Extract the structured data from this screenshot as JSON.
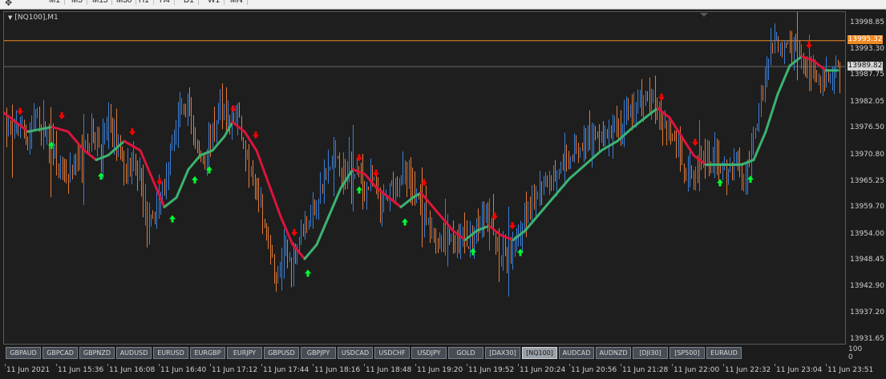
{
  "toolbar": {
    "timeframes": [
      "M1",
      "M5",
      "M15",
      "M30",
      "H1",
      "H4",
      "D1",
      "W1",
      "MN"
    ]
  },
  "chart": {
    "symbol_title": "[NQ100],M1",
    "bid_price": "13995.32",
    "current_price": "13989.82",
    "price_axis_labels": [
      "13998.85",
      "13993.30",
      "13987.75",
      "13982.05",
      "13976.50",
      "13970.80",
      "13965.25",
      "13959.70",
      "13954.00",
      "13948.45",
      "13942.90",
      "13937.20",
      "13931.65"
    ],
    "time_axis_labels": [
      "11 Jun 2021",
      "11 Jun 15:36",
      "11 Jun 16:08",
      "11 Jun 16:40",
      "11 Jun 17:12",
      "11 Jun 17:44",
      "11 Jun 18:16",
      "11 Jun 18:48",
      "11 Jun 19:20",
      "11 Jun 19:52",
      "11 Jun 20:24",
      "11 Jun 20:56",
      "11 Jun 21:28",
      "11 Jun 22:00",
      "11 Jun 22:32",
      "11 Jun 23:04",
      "11 Jun 23:51"
    ],
    "colors": {
      "background": "#1e1e1e",
      "bull_bar": "#3a7fd8",
      "bear_bar": "#e07a3a",
      "ma_up": "#3cb371",
      "ma_down": "#dc143c",
      "bid_line": "#f08a24",
      "arrow_up": "#00ff33",
      "arrow_down": "#ff0000"
    }
  },
  "chart_data": {
    "type": "ohlc",
    "y_range": [
      13931.65,
      13998.85
    ],
    "price_path": [
      [
        0,
        13980
      ],
      [
        10,
        13975
      ],
      [
        20,
        13978
      ],
      [
        30,
        13973
      ],
      [
        40,
        13980
      ],
      [
        50,
        13976
      ],
      [
        60,
        13974
      ],
      [
        70,
        13968
      ],
      [
        80,
        13965
      ],
      [
        90,
        13969
      ],
      [
        100,
        13972
      ],
      [
        110,
        13976
      ],
      [
        120,
        13972
      ],
      [
        130,
        13978
      ],
      [
        140,
        13975
      ],
      [
        150,
        13968
      ],
      [
        160,
        13970
      ],
      [
        170,
        13965
      ],
      [
        180,
        13955
      ],
      [
        190,
        13960
      ],
      [
        200,
        13965
      ],
      [
        210,
        13975
      ],
      [
        220,
        13980
      ],
      [
        230,
        13982
      ],
      [
        240,
        13972
      ],
      [
        250,
        13970
      ],
      [
        260,
        13976
      ],
      [
        270,
        13982
      ],
      [
        280,
        13978
      ],
      [
        290,
        13980
      ],
      [
        300,
        13972
      ],
      [
        310,
        13966
      ],
      [
        320,
        13960
      ],
      [
        330,
        13950
      ],
      [
        340,
        13945
      ],
      [
        350,
        13950
      ],
      [
        360,
        13948
      ],
      [
        370,
        13955
      ],
      [
        380,
        13958
      ],
      [
        390,
        13962
      ],
      [
        400,
        13966
      ],
      [
        410,
        13970
      ],
      [
        420,
        13968
      ],
      [
        430,
        13966
      ],
      [
        440,
        13968
      ],
      [
        450,
        13963
      ],
      [
        460,
        13966
      ],
      [
        470,
        13960
      ],
      [
        480,
        13963
      ],
      [
        490,
        13966
      ],
      [
        500,
        13968
      ],
      [
        510,
        13963
      ],
      [
        520,
        13960
      ],
      [
        530,
        13955
      ],
      [
        540,
        13953
      ],
      [
        550,
        13955
      ],
      [
        560,
        13952
      ],
      [
        570,
        13954
      ],
      [
        580,
        13953
      ],
      [
        590,
        13956
      ],
      [
        600,
        13958
      ],
      [
        610,
        13954
      ],
      [
        620,
        13950
      ],
      [
        630,
        13952
      ],
      [
        640,
        13955
      ],
      [
        650,
        13958
      ],
      [
        660,
        13962
      ],
      [
        670,
        13966
      ],
      [
        680,
        13965
      ],
      [
        690,
        13968
      ],
      [
        700,
        13970
      ],
      [
        710,
        13972
      ],
      [
        720,
        13973
      ],
      [
        730,
        13975
      ],
      [
        740,
        13976
      ],
      [
        750,
        13975
      ],
      [
        760,
        13977
      ],
      [
        770,
        13978
      ],
      [
        780,
        13980
      ],
      [
        790,
        13982
      ],
      [
        800,
        13983
      ],
      [
        810,
        13982
      ],
      [
        820,
        13978
      ],
      [
        830,
        13975
      ],
      [
        840,
        13972
      ],
      [
        850,
        13968
      ],
      [
        860,
        13966
      ],
      [
        870,
        13970
      ],
      [
        880,
        13969
      ],
      [
        890,
        13970
      ],
      [
        900,
        13968
      ],
      [
        910,
        13970
      ],
      [
        920,
        13966
      ],
      [
        930,
        13970
      ],
      [
        940,
        13980
      ],
      [
        950,
        13990
      ],
      [
        960,
        13995
      ],
      [
        970,
        13993
      ],
      [
        980,
        13995
      ],
      [
        990,
        13992
      ],
      [
        1000,
        13990
      ],
      [
        1010,
        13989
      ],
      [
        1020,
        13988
      ],
      [
        1030,
        13989
      ],
      [
        1040,
        13990
      ]
    ],
    "ma_line": [
      [
        0,
        13980
      ],
      [
        30,
        13976
      ],
      [
        60,
        13977
      ],
      [
        80,
        13976
      ],
      [
        100,
        13972
      ],
      [
        115,
        13970
      ],
      [
        130,
        13971
      ],
      [
        150,
        13974
      ],
      [
        170,
        13972
      ],
      [
        185,
        13966
      ],
      [
        200,
        13960
      ],
      [
        215,
        13962
      ],
      [
        230,
        13968
      ],
      [
        245,
        13971
      ],
      [
        260,
        13972
      ],
      [
        275,
        13975
      ],
      [
        285,
        13978
      ],
      [
        300,
        13976
      ],
      [
        315,
        13972
      ],
      [
        330,
        13965
      ],
      [
        345,
        13958
      ],
      [
        360,
        13952
      ],
      [
        375,
        13949
      ],
      [
        390,
        13952
      ],
      [
        405,
        13958
      ],
      [
        420,
        13964
      ],
      [
        435,
        13968
      ],
      [
        450,
        13967
      ],
      [
        465,
        13964
      ],
      [
        480,
        13962
      ],
      [
        495,
        13960
      ],
      [
        510,
        13962
      ],
      [
        520,
        13963
      ],
      [
        540,
        13959
      ],
      [
        560,
        13955
      ],
      [
        575,
        13953
      ],
      [
        590,
        13955
      ],
      [
        605,
        13956
      ],
      [
        620,
        13954
      ],
      [
        635,
        13953
      ],
      [
        650,
        13955
      ],
      [
        665,
        13958
      ],
      [
        685,
        13962
      ],
      [
        705,
        13966
      ],
      [
        725,
        13969
      ],
      [
        745,
        13972
      ],
      [
        765,
        13974
      ],
      [
        785,
        13977
      ],
      [
        800,
        13979
      ],
      [
        815,
        13981
      ],
      [
        830,
        13979
      ],
      [
        845,
        13975
      ],
      [
        860,
        13971
      ],
      [
        875,
        13969
      ],
      [
        890,
        13969
      ],
      [
        905,
        13969
      ],
      [
        920,
        13969
      ],
      [
        935,
        13970
      ],
      [
        950,
        13976
      ],
      [
        965,
        13984
      ],
      [
        980,
        13990
      ],
      [
        995,
        13992
      ],
      [
        1010,
        13991
      ],
      [
        1025,
        13989
      ],
      [
        1040,
        13989
      ]
    ],
    "arrows_up": [
      59,
      121,
      210,
      238,
      256,
      379,
      443,
      500,
      585,
      644,
      893,
      931
    ],
    "arrows_down": [
      20,
      72,
      160,
      194,
      286,
      314,
      362,
      443,
      464,
      524,
      612,
      634,
      820,
      862,
      1004
    ]
  },
  "symbol_buttons": {
    "items": [
      "GBPAUD",
      "GBPCAD",
      "GBPNZD",
      "AUDUSD",
      "EURUSD",
      "EURGBP",
      "EURJPY",
      "GBPUSD",
      "GBPJPY",
      "USDCAD",
      "USDCHF",
      "USDJPY",
      "GOLD",
      "[DAX30]",
      "[NQ100]",
      "AUDCAD",
      "AUDNZD",
      "[DJI30]",
      "[SP500]",
      "EURAUD"
    ],
    "active": "[NQ100]"
  },
  "sub_axis": {
    "top": "100",
    "bottom": "0"
  }
}
